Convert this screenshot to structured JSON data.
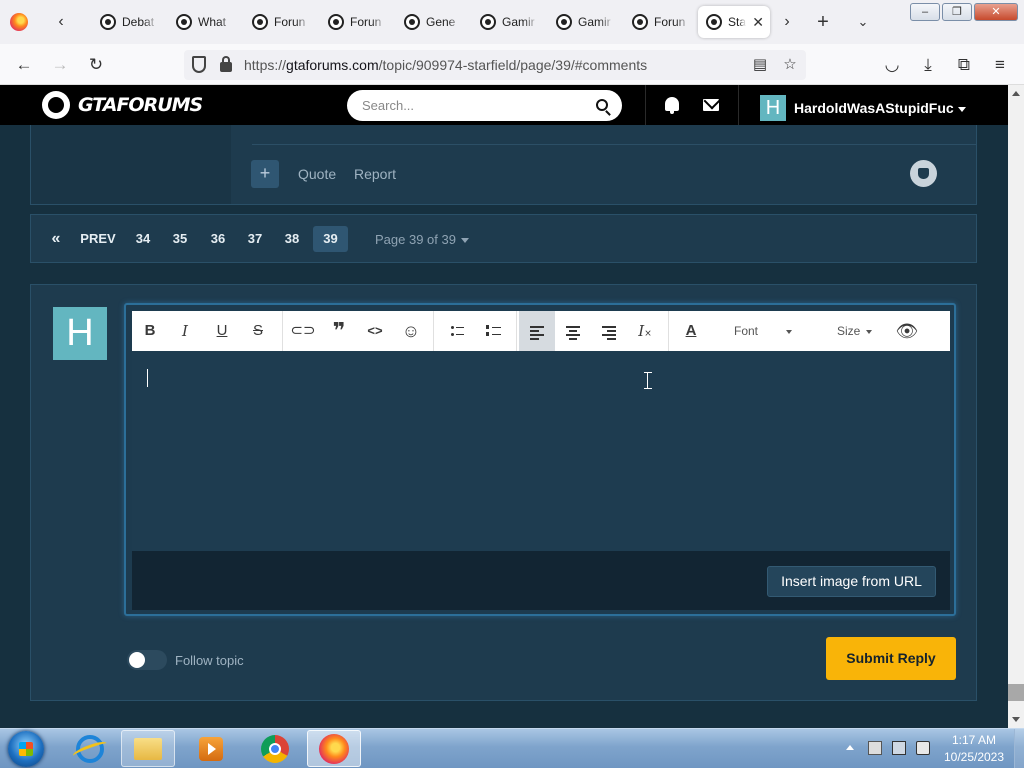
{
  "browser": {
    "tabs": [
      {
        "label": "Debat"
      },
      {
        "label": "What"
      },
      {
        "label": "Forun"
      },
      {
        "label": "Forun"
      },
      {
        "label": "Gene"
      },
      {
        "label": "Gamir"
      },
      {
        "label": "Gamir"
      },
      {
        "label": "Forun"
      },
      {
        "label": "Sta",
        "active": true
      }
    ],
    "url_prefix": "https://",
    "url_domain": "gtaforums.com",
    "url_path": "/topic/909974-starfield/page/39/#comments"
  },
  "site": {
    "logo_text": "GTAFORUMS",
    "search_placeholder": "Search...",
    "user_initial": "H",
    "username": "HardoldWasAStupidFuc"
  },
  "post": {
    "quote_label": "Quote",
    "report_label": "Report",
    "plus_label": "+"
  },
  "pagination": {
    "prev_label": "PREV",
    "first_symbol": "«",
    "pages": [
      "34",
      "35",
      "36",
      "37",
      "38",
      "39"
    ],
    "current_page": "39",
    "page_of_label": "Page 39 of 39"
  },
  "reply": {
    "avatar_initial": "H",
    "toolbar": {
      "bold": "B",
      "italic": "I",
      "underline": "U",
      "strike": "S",
      "quote": "❞",
      "code": "<>",
      "emoji": "☺",
      "font_label": "Font",
      "size_label": "Size",
      "text_color": "A"
    },
    "insert_image_label": "Insert image from URL",
    "follow_label": "Follow topic",
    "submit_label": "Submit Reply"
  },
  "taskbar": {
    "time": "1:17 AM",
    "date": "10/25/2023"
  },
  "colors": {
    "accent": "#f9b408",
    "avatar": "#63b6c0",
    "panel": "#1e3b4e",
    "page_bg": "#16303f"
  }
}
